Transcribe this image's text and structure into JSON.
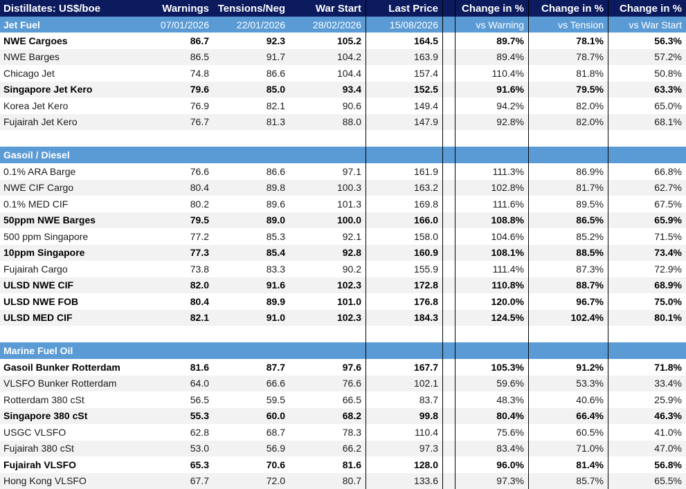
{
  "header": {
    "title": "Distillates: US$/boe",
    "cols": [
      "Warnings",
      "Tensions/Neg",
      "War Start",
      "Last Price",
      "",
      "Change in %",
      "Change in %",
      "Change in %"
    ],
    "dates": [
      "07/01/2026",
      "22/01/2026",
      "28/02/2026",
      "15/08/2026",
      "",
      "vs Warning",
      "vs Tension",
      "vs War Start"
    ]
  },
  "sections": [
    {
      "name": "Jet Fuel",
      "rows": [
        {
          "label": "NWE Cargoes",
          "bold": true,
          "values": [
            "86.7",
            "92.3",
            "105.2",
            "164.5",
            "89.7%",
            "78.1%",
            "56.3%"
          ]
        },
        {
          "label": "NWE Barges",
          "bold": false,
          "values": [
            "86.5",
            "91.7",
            "104.2",
            "163.9",
            "89.4%",
            "78.7%",
            "57.2%"
          ]
        },
        {
          "label": "Chicago Jet",
          "bold": false,
          "values": [
            "74.8",
            "86.6",
            "104.4",
            "157.4",
            "110.4%",
            "81.8%",
            "50.8%"
          ]
        },
        {
          "label": "Singapore Jet Kero",
          "bold": true,
          "values": [
            "79.6",
            "85.0",
            "93.4",
            "152.5",
            "91.6%",
            "79.5%",
            "63.3%"
          ]
        },
        {
          "label": "Korea Jet Kero",
          "bold": false,
          "values": [
            "76.9",
            "82.1",
            "90.6",
            "149.4",
            "94.2%",
            "82.0%",
            "65.0%"
          ]
        },
        {
          "label": "Fujairah Jet Kero",
          "bold": false,
          "values": [
            "76.7",
            "81.3",
            "88.0",
            "147.9",
            "92.8%",
            "82.0%",
            "68.1%"
          ]
        }
      ]
    },
    {
      "name": "Gasoil / Diesel",
      "rows": [
        {
          "label": "0.1% ARA Barge",
          "bold": false,
          "values": [
            "76.6",
            "86.6",
            "97.1",
            "161.9",
            "111.3%",
            "86.9%",
            "66.8%"
          ]
        },
        {
          "label": "NWE CIF Cargo",
          "bold": false,
          "values": [
            "80.4",
            "89.8",
            "100.3",
            "163.2",
            "102.8%",
            "81.7%",
            "62.7%"
          ]
        },
        {
          "label": "0.1% MED CIF",
          "bold": false,
          "values": [
            "80.2",
            "89.6",
            "101.3",
            "169.8",
            "111.6%",
            "89.5%",
            "67.5%"
          ]
        },
        {
          "label": "50ppm NWE Barges",
          "bold": true,
          "values": [
            "79.5",
            "89.0",
            "100.0",
            "166.0",
            "108.8%",
            "86.5%",
            "65.9%"
          ]
        },
        {
          "label": "500 ppm Singapore",
          "bold": false,
          "values": [
            "77.2",
            "85.3",
            "92.1",
            "158.0",
            "104.6%",
            "85.2%",
            "71.5%"
          ]
        },
        {
          "label": "10ppm Singapore",
          "bold": true,
          "values": [
            "77.3",
            "85.4",
            "92.8",
            "160.9",
            "108.1%",
            "88.5%",
            "73.4%"
          ]
        },
        {
          "label": "Fujairah Cargo",
          "bold": false,
          "values": [
            "73.8",
            "83.3",
            "90.2",
            "155.9",
            "111.4%",
            "87.3%",
            "72.9%"
          ]
        },
        {
          "label": "ULSD NWE CIF",
          "bold": true,
          "values": [
            "82.0",
            "91.6",
            "102.3",
            "172.8",
            "110.8%",
            "88.7%",
            "68.9%"
          ]
        },
        {
          "label": "ULSD NWE FOB",
          "bold": true,
          "values": [
            "80.4",
            "89.9",
            "101.0",
            "176.8",
            "120.0%",
            "96.7%",
            "75.0%"
          ]
        },
        {
          "label": "ULSD MED CIF",
          "bold": true,
          "values": [
            "82.1",
            "91.0",
            "102.3",
            "184.3",
            "124.5%",
            "102.4%",
            "80.1%"
          ]
        }
      ]
    },
    {
      "name": "Marine Fuel Oil",
      "rows": [
        {
          "label": "Gasoil Bunker Rotterdam",
          "bold": true,
          "values": [
            "81.6",
            "87.7",
            "97.6",
            "167.7",
            "105.3%",
            "91.2%",
            "71.8%"
          ]
        },
        {
          "label": "VLSFO Bunker Rotterdam",
          "bold": false,
          "values": [
            "64.0",
            "66.6",
            "76.6",
            "102.1",
            "59.6%",
            "53.3%",
            "33.4%"
          ]
        },
        {
          "label": "Rotterdam 380 cSt",
          "bold": false,
          "values": [
            "56.5",
            "59.5",
            "66.5",
            "83.7",
            "48.3%",
            "40.6%",
            "25.9%"
          ]
        },
        {
          "label": "Singapore 380 cSt",
          "bold": true,
          "values": [
            "55.3",
            "60.0",
            "68.2",
            "99.8",
            "80.4%",
            "66.4%",
            "46.3%"
          ]
        },
        {
          "label": "USGC VLSFO",
          "bold": false,
          "values": [
            "62.8",
            "68.7",
            "78.3",
            "110.4",
            "75.6%",
            "60.5%",
            "41.0%"
          ]
        },
        {
          "label": "Fujairah 380 cSt",
          "bold": false,
          "values": [
            "53.0",
            "56.9",
            "66.2",
            "97.3",
            "83.4%",
            "71.0%",
            "47.0%"
          ]
        },
        {
          "label": "Fujairah VLSFO",
          "bold": true,
          "values": [
            "65.3",
            "70.6",
            "81.6",
            "128.0",
            "96.0%",
            "81.4%",
            "56.8%"
          ]
        },
        {
          "label": "Hong Kong VLSFO",
          "bold": false,
          "values": [
            "67.7",
            "72.0",
            "80.7",
            "133.6",
            "97.3%",
            "85.7%",
            "65.5%"
          ]
        }
      ]
    }
  ],
  "colors": {
    "header_bg": "#0c1a5e",
    "section_bg": "#5b9bd5",
    "alt_row": "#f2f2f2"
  }
}
